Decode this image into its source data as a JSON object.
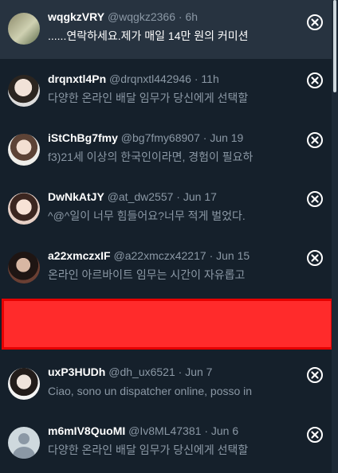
{
  "colors": {
    "background": "#15202b",
    "active_row": "#273340",
    "name": "#ffffff",
    "muted": "#8b98a5",
    "redaction": "#ff2b2b"
  },
  "icons": {
    "close": "close-circle-icon",
    "default_avatar": "default-avatar-icon"
  },
  "rows": [
    {
      "name": "wqgkzVRY",
      "handle": "@wqgkz2366",
      "time": "6h",
      "text": "......연락하세요.제가 매일 14만 원의 커미션"
    },
    {
      "name": "drqnxtl4Pn",
      "handle": "@drqnxtl442946",
      "time": "11h",
      "text": "다양한 온라인 배달 임무가 당신에게 선택할"
    },
    {
      "name": "iStChBg7fmy",
      "handle": "@bg7fmy68907",
      "time": "Jun 19",
      "text": "f3)21세 이상의 한국인이라면, 경험이 필요하"
    },
    {
      "name": "DwNkAtJY",
      "handle": "@at_dw2557",
      "time": "Jun 17",
      "text": "^@^일이 너무 힘들어요?너무 적게 벌었다."
    },
    {
      "name": "a22xmczxIF",
      "handle": "@a22xmczx42217",
      "time": "Jun 15",
      "text": "온라인 아르바이트 임무는 시간이 자유롭고"
    },
    {
      "name": "uxP3HUDh",
      "handle": "@dh_ux6521",
      "time": "Jun 7",
      "text": "Ciao, sono un dispatcher online, posso in"
    },
    {
      "name": "m6mIV8QuoMI",
      "handle": "@Iv8ML47381",
      "time": "Jun 6",
      "text": "다양한 온라인 배달 임무가 당신에게 선택할"
    }
  ],
  "separator": "·"
}
